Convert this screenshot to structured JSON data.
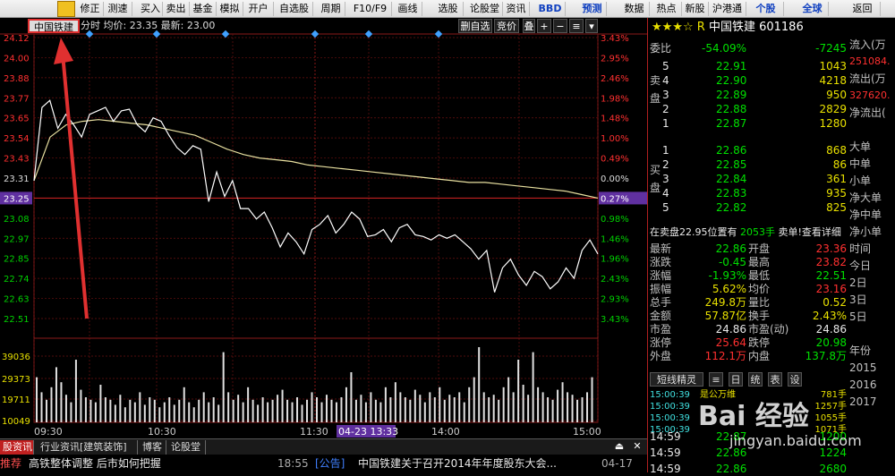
{
  "toolbar": {
    "items": [
      "修正",
      "测速",
      "买入",
      "卖出",
      "基金",
      "模拟",
      "开户",
      "自选股",
      "周期",
      "F10/F9",
      "画线",
      "选股",
      "论股堂",
      "资讯",
      "BBD",
      "预测",
      "数据",
      "热点",
      "新股",
      "沪港通",
      "个股",
      "全球",
      "返回"
    ]
  },
  "chart_header": {
    "stock_tab": "中国铁建",
    "info": "分时 均价: 23.35 最新: 23.00",
    "add_watch": "删自选",
    "auction": "竞价",
    "overlay": "叠",
    "plus": "+",
    "minus": "−",
    "menu": "≡"
  },
  "chart_data": {
    "type": "line",
    "x_labels": [
      "09:30",
      "10:30",
      "11:30",
      "04-23 13:33",
      "14:00",
      "15:00"
    ],
    "price_axis": [
      "24.12",
      "24.00",
      "23.88",
      "23.77",
      "23.65",
      "23.54",
      "23.43",
      "23.31",
      "23.25",
      "23.08",
      "22.97",
      "22.85",
      "22.74",
      "22.63",
      "22.51"
    ],
    "pct_axis": [
      "3.43%",
      "2.95%",
      "2.46%",
      "1.98%",
      "1.48%",
      "1.00%",
      "0.49%",
      "0.00%",
      "0.27%",
      "0.98%",
      "1.46%",
      "1.96%",
      "2.43%",
      "2.93%",
      "3.43%"
    ],
    "volume_axis": [
      "39036",
      "29373",
      "19711",
      "10049"
    ],
    "prev_close": 23.31,
    "ylim": [
      22.51,
      24.12
    ],
    "series": [
      {
        "values": [
          23.3,
          23.72,
          23.76,
          23.6,
          23.68,
          23.62,
          23.55,
          23.68,
          23.7,
          23.72,
          23.64,
          23.7,
          23.71,
          23.62,
          23.58,
          23.66,
          23.64,
          23.56,
          23.49,
          23.45,
          23.5,
          23.48,
          23.18,
          23.35,
          23.21,
          23.3,
          23.14,
          23.14,
          23.08,
          23.12,
          23.03,
          22.92,
          23.0,
          22.95,
          22.88,
          23.02,
          23.05,
          23.1,
          23.0,
          23.05,
          23.12,
          23.08,
          22.98,
          22.99,
          23.02,
          22.95,
          23.03,
          23.05,
          22.99,
          22.98,
          22.96,
          22.99,
          22.97,
          22.99,
          22.95,
          22.91,
          22.85,
          22.9,
          22.66,
          22.8,
          22.85,
          22.76,
          22.7,
          22.78,
          22.75,
          22.68,
          22.72,
          22.8,
          22.74,
          22.9,
          22.96,
          22.88
        ]
      },
      {
        "values": [
          23.3,
          23.55,
          23.62,
          23.64,
          23.65,
          23.64,
          23.63,
          23.62,
          23.6,
          23.58,
          23.56,
          23.52,
          23.48,
          23.45,
          23.43,
          23.42,
          23.41,
          23.39,
          23.38,
          23.37,
          23.36,
          23.35,
          23.34,
          23.33,
          23.32,
          23.31,
          23.3,
          23.29,
          23.29,
          23.28,
          23.27,
          23.26,
          23.25,
          23.24,
          23.22,
          23.2
        ]
      }
    ],
    "volumes": [
      18,
      12,
      9,
      14,
      22,
      16,
      11,
      8,
      25,
      13,
      10,
      9,
      8,
      15,
      10,
      9,
      7,
      11,
      6,
      9,
      8,
      12,
      7,
      10,
      9,
      6,
      8,
      10,
      7,
      9,
      14,
      8,
      6,
      9,
      12,
      8,
      10,
      7,
      28,
      12,
      9,
      11,
      8,
      14,
      9,
      7,
      10,
      8,
      9,
      11,
      13,
      9,
      8,
      10,
      7,
      9,
      12,
      10,
      8,
      11,
      9,
      8,
      10,
      14,
      20,
      9,
      11,
      8,
      12,
      9,
      8,
      14,
      10,
      16,
      12,
      10,
      9,
      13,
      11,
      8,
      12,
      10,
      14,
      9,
      11,
      10,
      12,
      8,
      14,
      18,
      30,
      12,
      10,
      11,
      9,
      14,
      18,
      12,
      25,
      15,
      11,
      28,
      14,
      12,
      10,
      9,
      13,
      16,
      12,
      11,
      9,
      10,
      12,
      18
    ]
  },
  "right_panel": {
    "star_prefix": "★★★☆ R",
    "stock_name": "中国铁建",
    "stock_code": "601186",
    "weibi_label": "委比",
    "weibi_pct": "-54.09%",
    "weibi_val": "-7245",
    "sell_tag": "卖盘",
    "buy_tag": "买盘",
    "sells": [
      {
        "n": "5",
        "price": "22.91",
        "vol": "1043"
      },
      {
        "n": "4",
        "price": "22.90",
        "vol": "4218"
      },
      {
        "n": "3",
        "price": "22.89",
        "vol": "950"
      },
      {
        "n": "2",
        "price": "22.88",
        "vol": "2829"
      },
      {
        "n": "1",
        "price": "22.87",
        "vol": "1280"
      }
    ],
    "buys": [
      {
        "n": "1",
        "price": "22.86",
        "vol": "868"
      },
      {
        "n": "2",
        "price": "22.85",
        "vol": "86"
      },
      {
        "n": "3",
        "price": "22.84",
        "vol": "361"
      },
      {
        "n": "4",
        "price": "22.83",
        "vol": "935"
      },
      {
        "n": "5",
        "price": "22.82",
        "vol": "825"
      }
    ],
    "order_note": "在卖盘22.95位置有",
    "order_note_vol": "2053手",
    "order_note_link": "卖单!查看详细",
    "stats": [
      {
        "l1": "最新",
        "v1": "22.86",
        "c1": "green",
        "l2": "开盘",
        "v2": "23.36",
        "c2": "red"
      },
      {
        "l1": "涨跌",
        "v1": "-0.45",
        "c1": "green",
        "l2": "最高",
        "v2": "23.82",
        "c2": "red"
      },
      {
        "l1": "涨幅",
        "v1": "-1.93%",
        "c1": "green",
        "l2": "最低",
        "v2": "22.51",
        "c2": "green"
      },
      {
        "l1": "振幅",
        "v1": "5.62%",
        "c1": "yellow",
        "l2": "均价",
        "v2": "23.16",
        "c2": "red"
      },
      {
        "l1": "总手",
        "v1": "249.8万",
        "c1": "yellow",
        "l2": "量比",
        "v2": "0.52",
        "c2": "yellow"
      },
      {
        "l1": "金额",
        "v1": "57.87亿",
        "c1": "yellow",
        "l2": "换手",
        "v2": "2.43%",
        "c2": "yellow"
      },
      {
        "l1": "市盈",
        "v1": "24.86",
        "c1": "white",
        "l2": "市盈(动)",
        "v2": "24.86",
        "c2": "white"
      },
      {
        "l1": "涨停",
        "v1": "25.64",
        "c1": "red",
        "l2": "跌停",
        "v2": "20.98",
        "c2": "green"
      },
      {
        "l1": "外盘",
        "v1": "112.1万",
        "c1": "red",
        "l2": "内盘",
        "v2": "137.8万",
        "c2": "green"
      }
    ],
    "tabs": [
      "短线精灵",
      "≡",
      "日",
      "统",
      "表",
      "设"
    ],
    "spirit": [
      {
        "time": "15:00:39",
        "text": "是公万维",
        "vol": "781手"
      },
      {
        "time": "15:00:39",
        "text": "",
        "vol": "1257手"
      },
      {
        "time": "15:00:39",
        "text": "",
        "vol": "1055手"
      },
      {
        "time": "15:00:39",
        "text": "",
        "vol": "1071手"
      }
    ],
    "ticks": [
      {
        "time": "14:59",
        "price": "22.87",
        "vol": "1200"
      },
      {
        "time": "14:59",
        "price": "22.86",
        "vol": "1224"
      },
      {
        "time": "14:59",
        "price": "22.86",
        "vol": "2680"
      }
    ],
    "far_col": [
      "流入(万",
      "251084.",
      "流出(万",
      "327620.",
      "净流出(",
      "",
      "大单",
      "中单",
      "小单",
      "净大单",
      "净中单",
      "净小单",
      "时间",
      "今日",
      "2日",
      "3日",
      "5日",
      "",
      "年份",
      "2015",
      "2016",
      "2017"
    ]
  },
  "bottom_tabs": [
    "股资讯",
    "行业资讯[建筑装饰]",
    "博客",
    "论股堂"
  ],
  "news": {
    "tag": "推荐",
    "headline": "高铁整体调整 后市如何把握",
    "time": "18:55",
    "notice_tag": "[公告]",
    "notice": "中国铁建关于召开2014年年度股东大会...",
    "date": "04-17"
  },
  "watermark": {
    "brand": "Bai 经验",
    "url": "jingyan.baidu.com"
  },
  "colors": {
    "up": "#ff3030",
    "down": "#00e000",
    "price_line": "#ffffff",
    "avg_line": "#e8e0a0",
    "highlight_red": "#e03030"
  }
}
